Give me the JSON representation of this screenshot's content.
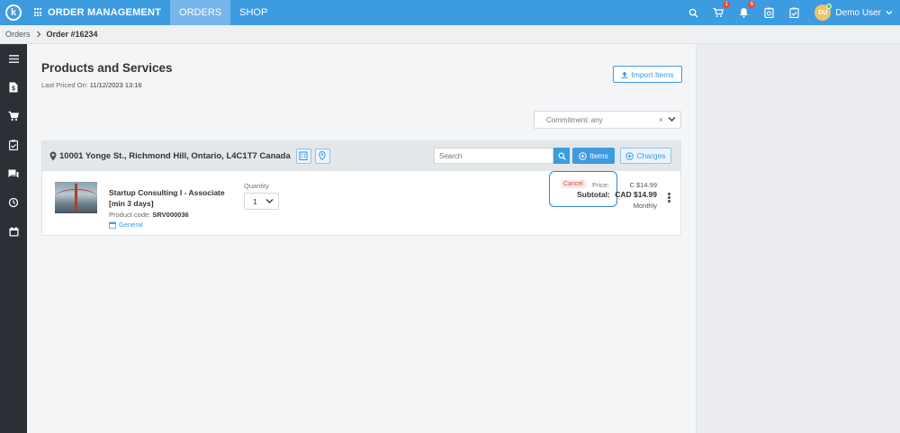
{
  "topbar": {
    "logo_letter": "k",
    "app_title": "ORDER MANAGEMENT",
    "tabs": [
      {
        "label": "ORDERS",
        "active": true
      },
      {
        "label": "SHOP",
        "active": false
      }
    ],
    "icons": {
      "search": "search-icon",
      "cart": "cart-icon",
      "notifications": "bell-icon",
      "tasks": "clipboard-clock-icon",
      "checklist": "clipboard-check-icon"
    },
    "cart_badge": "1",
    "bell_badge": "6",
    "user_initials": "DU",
    "user_name": "Demo User"
  },
  "breadcrumb": {
    "parent": "Orders",
    "current": "Order #16234"
  },
  "sidebar": {
    "items": [
      "menu-icon",
      "invoice-icon",
      "cart-icon",
      "clipboard-icon",
      "chat-icon",
      "history-icon",
      "calendar-icon"
    ]
  },
  "main": {
    "title": "Products and Services",
    "last_priced_label": "Last Priced On:",
    "last_priced_value": "11/12/2023 13:16",
    "import_label": "Import Items",
    "commitment_placeholder": "Commitment: any",
    "commitment_clear": "×",
    "location": {
      "address": "10001 Yonge St., Richmond Hill, Ontario, L4C1T7 Canada",
      "search_placeholder": "Search",
      "items_label": "Items",
      "charges_label": "Charges"
    },
    "product": {
      "name": "Startup Consulting I - Associate [min 3 days]",
      "code_label": "Product code:",
      "code_value": "SRV000036",
      "category": "General",
      "quantity_label": "Quantity",
      "quantity": "1",
      "cancel_label": "Cancel",
      "price_label": "Price:",
      "price_value": "C $14.99",
      "subtotal_label": "Subtotal:",
      "subtotal_value": "CAD $14.99",
      "period": "Monthly"
    }
  },
  "colors": {
    "primary": "#3d9be0",
    "sidebar": "#2c3036",
    "badge": "#e74c3c",
    "cancel": "#d9534f"
  }
}
